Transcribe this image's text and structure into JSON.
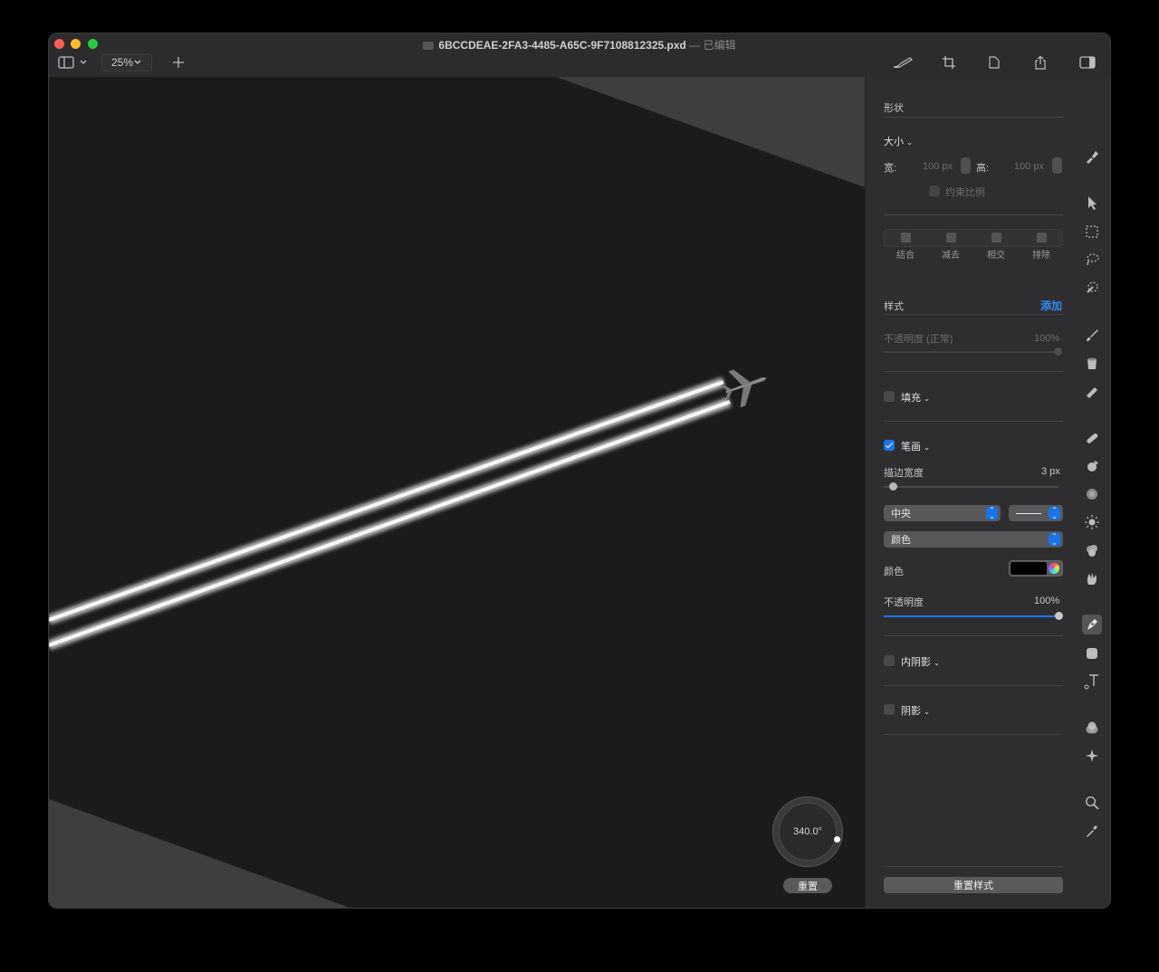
{
  "window": {
    "title": "6BCCDEAE-2FA3-4485-A65C-9F7108812325.pxd",
    "edited_status": "— 已编辑",
    "zoom": "25%"
  },
  "toolbar": {
    "icons": [
      "sidebar-icon",
      "chevron-down-icon",
      "plus-icon",
      "brush-icon",
      "crop-icon",
      "document-icon",
      "share-icon",
      "inspector-toggle-icon"
    ]
  },
  "canvas": {
    "rotation_value": "340.0°",
    "reset_label": "重置"
  },
  "inspector": {
    "shape_header": "形状",
    "size_label": "大小",
    "width_label": "宽:",
    "width_value": "100 px",
    "height_label": "高:",
    "height_value": "100 px",
    "constrain_label": "约束比例",
    "boolean_ops": [
      {
        "label": "结合",
        "icon": "union-icon"
      },
      {
        "label": "减去",
        "icon": "subtract-icon"
      },
      {
        "label": "相交",
        "icon": "intersect-icon"
      },
      {
        "label": "排除",
        "icon": "exclude-icon"
      }
    ],
    "style_header": "样式",
    "add_label": "添加",
    "layer_opacity_label": "不透明度 (正常)",
    "layer_opacity_value": "100%",
    "fill_label": "填充",
    "fill_checked": false,
    "stroke_label": "笔画",
    "stroke_checked": true,
    "stroke_width_label": "描边宽度",
    "stroke_width_value": "3 px",
    "stroke_width_level": 0.05,
    "position_select": "中央",
    "type_select": "颜色",
    "color_label": "颜色",
    "color_value": "#000000",
    "opacity_label": "不透明度",
    "opacity_value": "100%",
    "opacity_level": 1.0,
    "inner_shadow_label": "内阴影",
    "shadow_label": "阴影",
    "reset_style_label": "重置样式"
  },
  "tools": [
    "shape-style-icon",
    "arrow-pointer-icon",
    "rect-select-icon",
    "lasso-icon",
    "magic-wand-icon",
    "paint-brush-icon",
    "paint-bucket-icon",
    "eraser-icon",
    "bandage-icon",
    "clone-icon",
    "blur-icon",
    "sun-icon",
    "sponge-icon",
    "smudge-icon",
    "pen-icon",
    "rectangle-icon",
    "text-icon",
    "color-adjust-icon",
    "effects-icon",
    "magnifier-icon",
    "eyedropper-icon"
  ],
  "colors": {
    "accent": "#1a74e8",
    "link": "#2f8cf5",
    "close": "#ff5f57",
    "minimize": "#febc2e",
    "zoom": "#28c840"
  }
}
